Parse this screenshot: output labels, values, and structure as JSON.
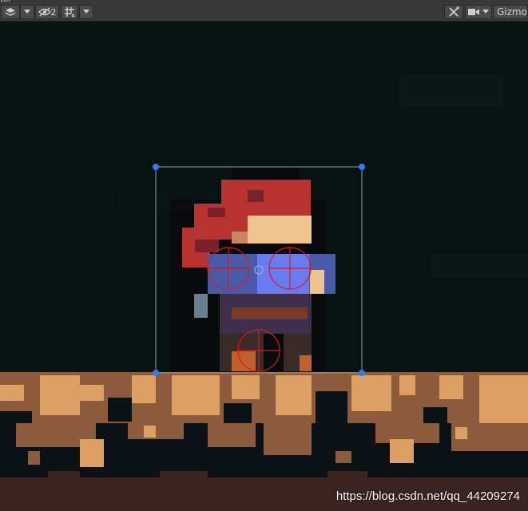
{
  "window": {
    "title_fragment": "tor"
  },
  "toolbar": {
    "layers_icon": "layers-icon",
    "visibility_count": "2",
    "grid_icon": "grid-snap-icon",
    "tools_icon": "tools-icon",
    "camera_icon": "camera-icon",
    "gizmos_label": "Gizmos"
  },
  "scene": {
    "watermark": "https://blog.csdn.net/qq_44209274",
    "colors": {
      "background": "#071211",
      "rect_outline": "#8aa5a5",
      "handle": "#2f7df0",
      "collider": "#e01818",
      "hair": "#b83232",
      "skin": "#f0c48e",
      "shirt": "#4a5aa8",
      "dirt_light": "#dca064",
      "dirt_dark": "#8c5a3c"
    }
  }
}
